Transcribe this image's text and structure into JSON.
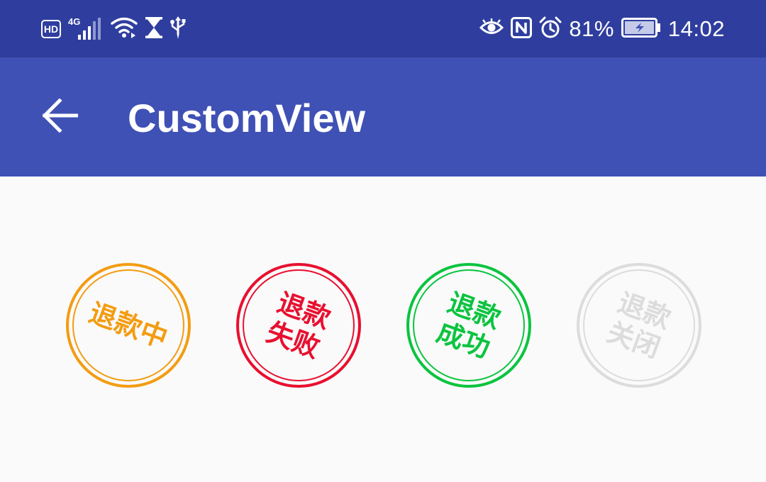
{
  "status_bar": {
    "hd_label": "HD",
    "network_label": "4G",
    "battery_percent": "81%",
    "time": "14:02",
    "icons": [
      "hd-icon",
      "signal-icon",
      "wifi-icon",
      "hourglass-icon",
      "usb-icon",
      "eye-icon",
      "nfc-icon",
      "alarm-icon",
      "battery-charging-icon"
    ]
  },
  "app_bar": {
    "title": "CustomView",
    "back_icon": "arrow-back-icon"
  },
  "stamps": [
    {
      "lines": [
        "退款中"
      ],
      "color": "#f39c12"
    },
    {
      "lines": [
        "退款",
        "失败"
      ],
      "color": "#e8102f"
    },
    {
      "lines": [
        "退款",
        "成功"
      ],
      "color": "#0bc43f"
    },
    {
      "lines": [
        "退款",
        "关闭"
      ],
      "color": "#dcdcdc"
    }
  ],
  "colors": {
    "status_bar": "#2f3e9e",
    "app_bar": "#3f51b5",
    "background": "#fafafa"
  }
}
